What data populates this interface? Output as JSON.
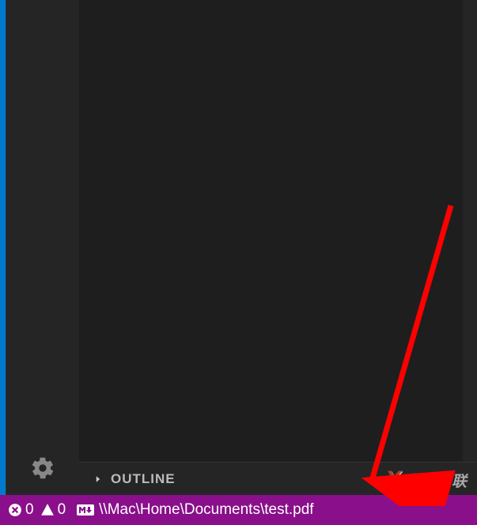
{
  "sidebar": {
    "outline_label": "OUTLINE"
  },
  "statusbar": {
    "errors_count": "0",
    "warnings_count": "0",
    "file_path": "\\\\Mac\\Home\\Documents\\test.pdf"
  },
  "watermark": {
    "logo_text": "X",
    "text": "自由互联"
  }
}
